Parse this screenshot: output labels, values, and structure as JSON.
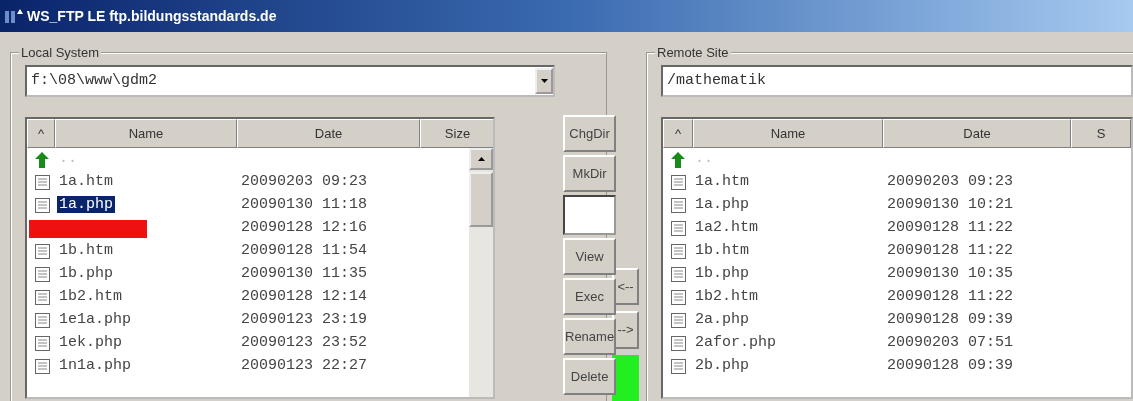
{
  "window": {
    "title": "WS_FTP LE ftp.bildungsstandards.de"
  },
  "local": {
    "title": "Local System",
    "path": "f:\\08\\www\\gdm2",
    "columns": [
      "^",
      "Name",
      "Date",
      "Size"
    ],
    "rows": [
      {
        "kind": "parent",
        "name": "..",
        "selected": false
      },
      {
        "kind": "file",
        "name": "1a.htm",
        "date": "20090203 09:23",
        "selected": false
      },
      {
        "kind": "file",
        "name": "1a.php",
        "date": "20090130 11:18",
        "selected": true
      },
      {
        "kind": "redacted",
        "date": "20090128 12:16",
        "selected": false
      },
      {
        "kind": "file",
        "name": "1b.htm",
        "date": "20090128 11:54",
        "selected": false
      },
      {
        "kind": "file",
        "name": "1b.php",
        "date": "20090130 11:35",
        "selected": false
      },
      {
        "kind": "file",
        "name": "1b2.htm",
        "date": "20090128 12:14",
        "selected": false
      },
      {
        "kind": "file",
        "name": "1e1a.php",
        "date": "20090123 23:19",
        "selected": false
      },
      {
        "kind": "file",
        "name": "1ek.php",
        "date": "20090123 23:52",
        "selected": false
      },
      {
        "kind": "file",
        "name": "1n1a.php",
        "date": "20090123 22:27",
        "selected": false
      }
    ]
  },
  "local_buttons": [
    {
      "kind": "button",
      "label": "ChgDir"
    },
    {
      "kind": "button",
      "label": "MkDir"
    },
    {
      "kind": "field"
    },
    {
      "kind": "button",
      "label": "View"
    },
    {
      "kind": "button",
      "label": "Exec"
    },
    {
      "kind": "button",
      "label": "Rename"
    },
    {
      "kind": "button",
      "label": "Delete"
    }
  ],
  "transfer_buttons": [
    "<--",
    "-->"
  ],
  "remote": {
    "title": "Remote Site",
    "path": "/mathematik",
    "columns": [
      "^",
      "Name",
      "Date",
      "S"
    ],
    "rows": [
      {
        "kind": "parent",
        "name": "..",
        "selected": false
      },
      {
        "kind": "file",
        "name": "1a.htm",
        "date": "20090203 09:23",
        "selected": false
      },
      {
        "kind": "file",
        "name": "1a.php",
        "date": "20090130 10:21",
        "selected": false
      },
      {
        "kind": "file",
        "name": "1a2.htm",
        "date": "20090128 11:22",
        "selected": false
      },
      {
        "kind": "file",
        "name": "1b.htm",
        "date": "20090128 11:22",
        "selected": false
      },
      {
        "kind": "file",
        "name": "1b.php",
        "date": "20090130 10:35",
        "selected": false
      },
      {
        "kind": "file",
        "name": "1b2.htm",
        "date": "20090128 11:22",
        "selected": false
      },
      {
        "kind": "file",
        "name": "2a.php",
        "date": "20090128 09:39",
        "selected": false
      },
      {
        "kind": "file",
        "name": "2afor.php",
        "date": "20090203 07:51",
        "selected": false
      },
      {
        "kind": "file",
        "name": "2b.php",
        "date": "20090128 09:39",
        "selected": false
      }
    ]
  }
}
